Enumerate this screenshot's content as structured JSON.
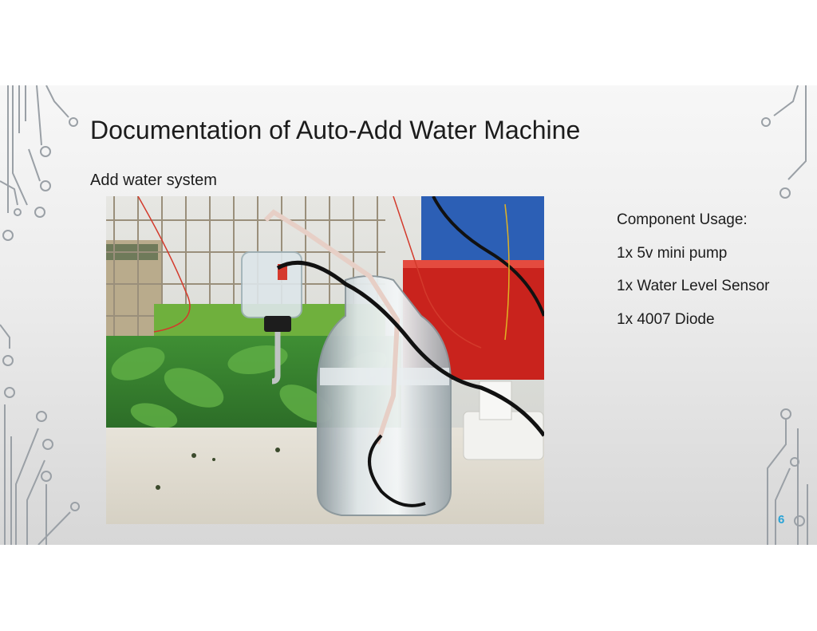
{
  "slide": {
    "title": "Documentation of Auto-Add Water Machine",
    "subtitle": "Add water system",
    "components": [
      "Component Usage:",
      "1x 5v mini pump",
      "1x Water Level Sensor",
      "1x 4007 Diode"
    ],
    "page_number": "6"
  },
  "colors": {
    "accent": "#29a3d6",
    "text": "#1c1c1c",
    "circuit": "#9aa0a6"
  }
}
